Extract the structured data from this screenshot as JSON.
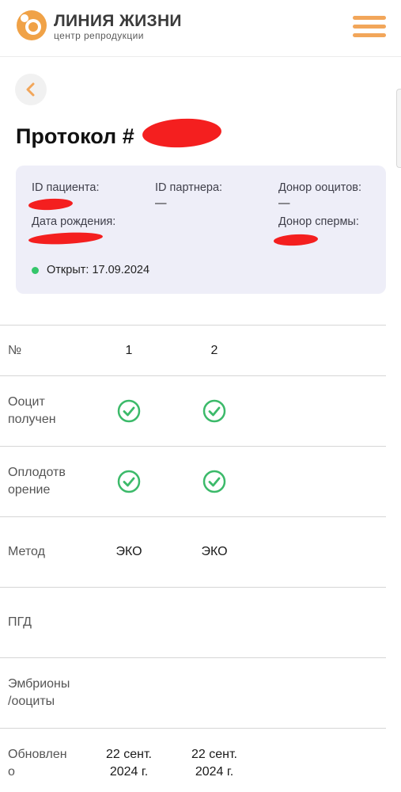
{
  "header": {
    "brand_title": "ЛИНИЯ ЖИЗНИ",
    "brand_subtitle": "центр репродукции",
    "icons": {
      "logo": "brand-logo-icon",
      "menu": "hamburger-menu-icon",
      "back": "chevron-left-icon"
    },
    "colors": {
      "accent": "#f2a65a",
      "logo_orange": "#f0a247"
    }
  },
  "page": {
    "title": "Протокол #"
  },
  "info": {
    "patient_id_label": "ID пациента:",
    "partner_id_label": "ID партнера:",
    "partner_id_value": "—",
    "oocyte_donor_label": "Донор ооцитов:",
    "oocyte_donor_value": "—",
    "birth_date_label": "Дата рождения:",
    "sperm_donor_label": "Донор спермы:",
    "status_text": "Открыт: 17.09.2024",
    "status_color": "#35c66b",
    "card_bg": "#eeeef8",
    "redaction_color": "#f41f1f"
  },
  "table": {
    "rows": [
      {
        "label": "№",
        "values": [
          "1",
          "2"
        ]
      },
      {
        "label": "Ооцит получен",
        "values": [
          true,
          true
        ]
      },
      {
        "label": "Оплодотворение",
        "values": [
          true,
          true
        ]
      },
      {
        "label": "Метод",
        "values": [
          "ЭКО",
          "ЭКО"
        ]
      },
      {
        "label": "ПГД",
        "values": [
          "",
          ""
        ]
      },
      {
        "label": "Эмбрионы /ооциты",
        "values": [
          "",
          ""
        ]
      },
      {
        "label": "Обновлено",
        "values": [
          "22 сент. 2024 г.",
          "22 сент. 2024 г."
        ]
      }
    ],
    "label_lines": {
      "r1": [
        "Ооцит",
        "получен"
      ],
      "r2": [
        "Оплодотв",
        "орение"
      ],
      "r5": [
        "Эмбрионы",
        "/ооциты"
      ],
      "r6": [
        "Обновлен",
        "о"
      ]
    },
    "date_lines": [
      "22 сент.",
      "2024 г."
    ],
    "check_icon": "check-circle-icon",
    "check_color": "#3cba6a"
  }
}
